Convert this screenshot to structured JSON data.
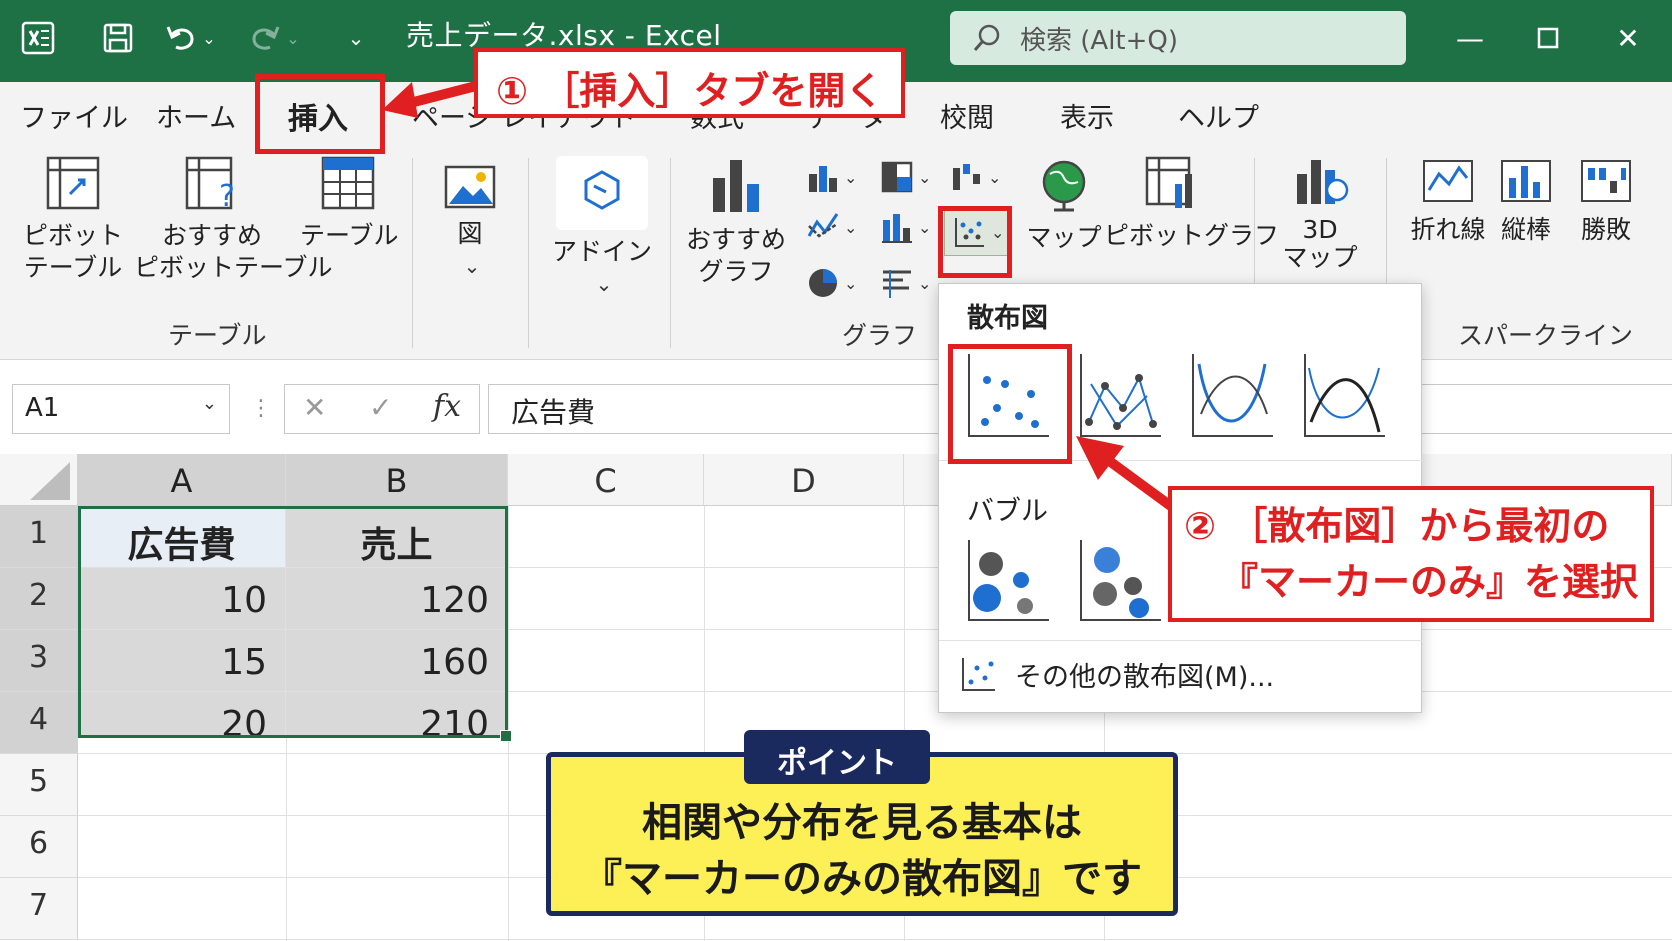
{
  "titlebar": {
    "title": "売上データ.xlsx  -  Excel",
    "search_placeholder": "検索 (Alt+Q)",
    "bg_color": "#1e7145"
  },
  "tabs": [
    "ファイル",
    "ホーム",
    "挿入",
    "ページ レイアウト",
    "数式",
    "データ",
    "校閲",
    "表示",
    "ヘルプ"
  ],
  "active_tab": "挿入",
  "ribbon": {
    "pivot_table": "ピボット\nテーブル",
    "recommended_pivot": "おすすめ\nピボットテーブル",
    "table": "テーブル",
    "group_table": "テーブル",
    "illustrations": "図",
    "addins": "アドイン",
    "recommended_charts": "おすすめ\nグラフ",
    "map": "マップ",
    "pivot_chart": "ピボットグラフ",
    "group_chart": "グラフ",
    "map3d": "3D\nマップ",
    "sparkline_line": "折れ線",
    "sparkline_column": "縦棒",
    "sparkline_winloss": "勝敗",
    "group_sparkline": "スパークライン"
  },
  "formula_bar": {
    "name_box": "A1",
    "formula": "広告費"
  },
  "sheet": {
    "columns": [
      "A",
      "B",
      "C",
      "D"
    ],
    "rows": [
      "1",
      "2",
      "3",
      "4",
      "5",
      "6",
      "7"
    ],
    "header": [
      "広告費",
      "売上"
    ],
    "data": [
      [
        "10",
        "120"
      ],
      [
        "15",
        "160"
      ],
      [
        "20",
        "210"
      ]
    ]
  },
  "dropdown": {
    "scatter_title": "散布図",
    "bubble_title": "バブル",
    "more": "その他の散布図(M)..."
  },
  "callouts": {
    "step1": "① ［挿入］タブを開く",
    "step2_line1": "② ［散布図］から最初の",
    "step2_line2": "『マーカーのみ』を選択",
    "point_tag": "ポイント",
    "point_line1": "相関や分布を見る基本は",
    "point_line2": "『マーカーのみの散布図』です",
    "accent_red": "#e02020",
    "point_bg": "#fdf056"
  }
}
